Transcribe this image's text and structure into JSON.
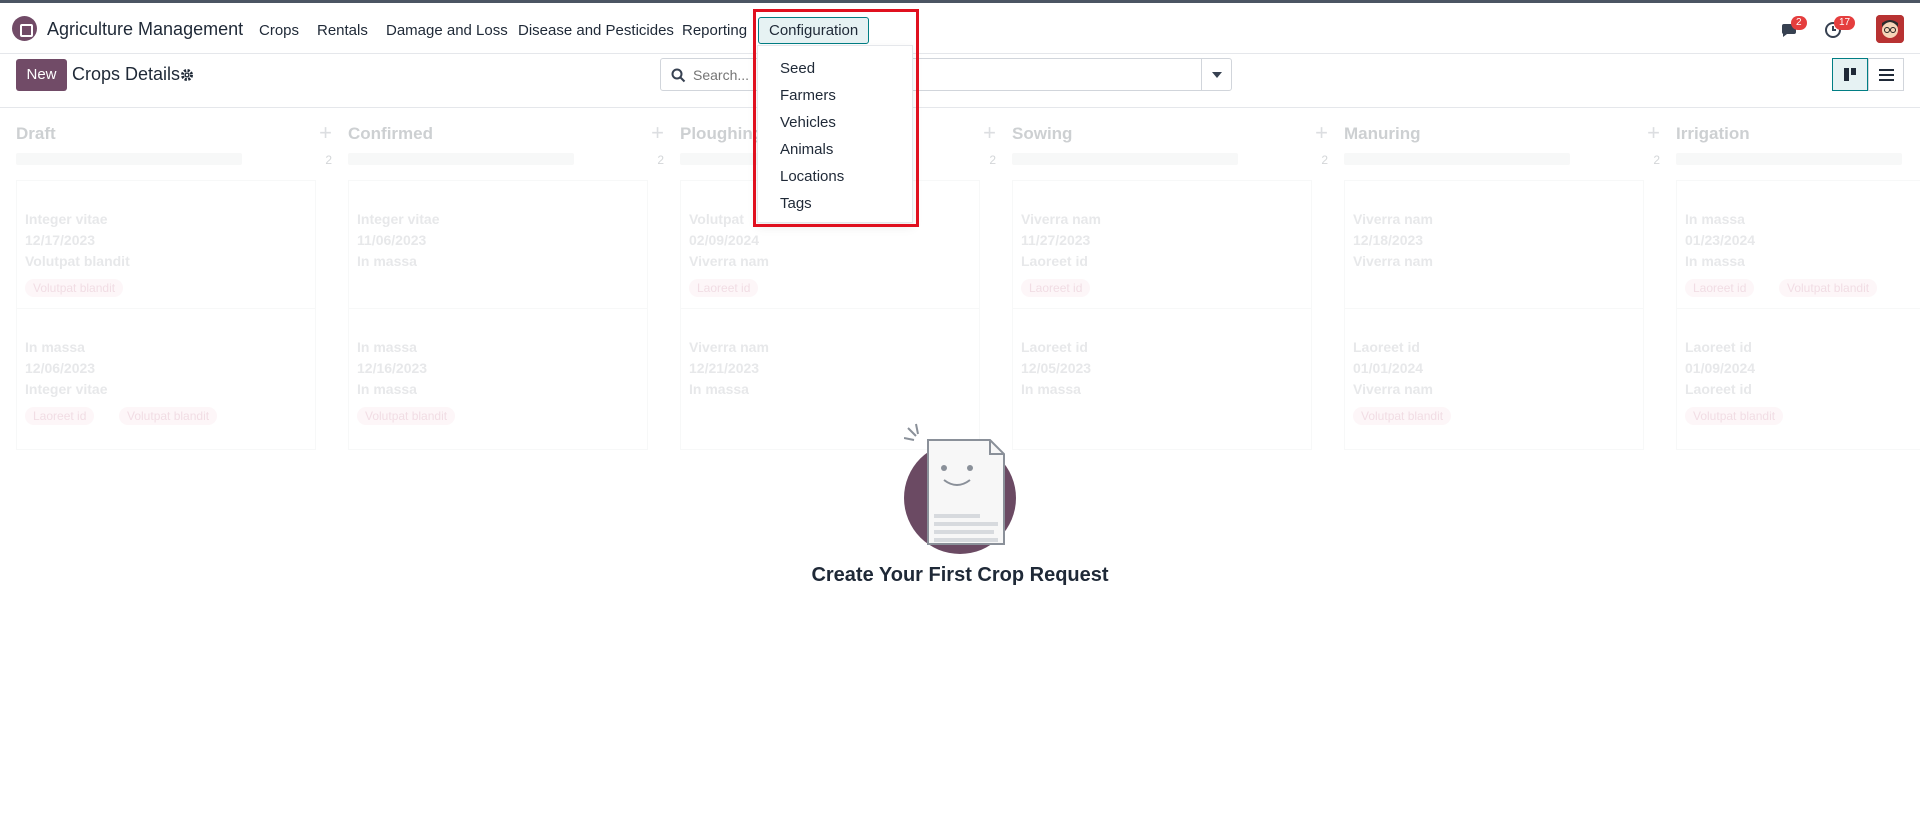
{
  "navbar": {
    "app_title": "Agriculture Management",
    "menus": [
      "Crops",
      "Rentals",
      "Damage and Loss",
      "Disease and Pesticides",
      "Reporting",
      "Configuration"
    ],
    "messages_badge": "2",
    "activities_badge": "17"
  },
  "control_panel": {
    "new_label": "New",
    "breadcrumb": "Crops Details",
    "search_placeholder": "Search..."
  },
  "kanban": {
    "columns": [
      {
        "title": "Draft",
        "count": "2",
        "cards": [
          {
            "lines": [
              "Integer vitae",
              "12/17/2023",
              "Volutpat blandit"
            ],
            "tags": [
              "Volutpat blandit"
            ]
          },
          {
            "lines": [
              "In massa",
              "12/06/2023",
              "Integer vitae"
            ],
            "tags": [
              "Laoreet id",
              "Volutpat blandit"
            ]
          }
        ]
      },
      {
        "title": "Confirmed",
        "count": "2",
        "cards": [
          {
            "lines": [
              "Integer vitae",
              "11/06/2023",
              "In massa"
            ],
            "tags": []
          },
          {
            "lines": [
              "In massa",
              "12/16/2023",
              "In massa"
            ],
            "tags": [
              "Volutpat blandit"
            ]
          }
        ]
      },
      {
        "title": "Ploughing",
        "count": "2",
        "cards": [
          {
            "lines": [
              "Volutpat",
              "02/09/2024",
              "Viverra nam"
            ],
            "tags": [
              "Laoreet id"
            ]
          },
          {
            "lines": [
              "Viverra nam",
              "12/21/2023",
              "In massa"
            ],
            "tags": []
          }
        ]
      },
      {
        "title": "Sowing",
        "count": "2",
        "cards": [
          {
            "lines": [
              "Viverra nam",
              "11/27/2023",
              "Laoreet id"
            ],
            "tags": [
              "Laoreet id"
            ]
          },
          {
            "lines": [
              "Laoreet id",
              "12/05/2023",
              "In massa"
            ],
            "tags": []
          }
        ]
      },
      {
        "title": "Manuring",
        "count": "2",
        "cards": [
          {
            "lines": [
              "Viverra nam",
              "12/18/2023",
              "Viverra nam"
            ],
            "tags": []
          },
          {
            "lines": [
              "Laoreet id",
              "01/01/2024",
              "Viverra nam"
            ],
            "tags": [
              "Volutpat blandit"
            ]
          }
        ]
      },
      {
        "title": "Irrigation",
        "count": "",
        "cards": [
          {
            "lines": [
              "In massa",
              "01/23/2024",
              "In massa"
            ],
            "tags": [
              "Laoreet id",
              "Volutpat blandit"
            ]
          },
          {
            "lines": [
              "Laoreet id",
              "01/09/2024",
              "Laoreet id"
            ],
            "tags": [
              "Volutpat blandit"
            ]
          }
        ]
      }
    ]
  },
  "helper": {
    "title": "Create Your First Crop Request"
  },
  "config_menu": {
    "items": [
      "Seed",
      "Farmers",
      "Vehicles",
      "Animals",
      "Locations",
      "Tags"
    ]
  },
  "colors": {
    "brand": "#714b67",
    "accent": "#017e84",
    "highlight": "#e0101f",
    "badge": "#e53e3e"
  },
  "icons": [
    "app-logo-icon",
    "gear-icon",
    "search-icon",
    "caret-down-icon",
    "chat-icon",
    "clock-icon",
    "kanban-view-icon",
    "list-view-icon",
    "plus-icon"
  ]
}
